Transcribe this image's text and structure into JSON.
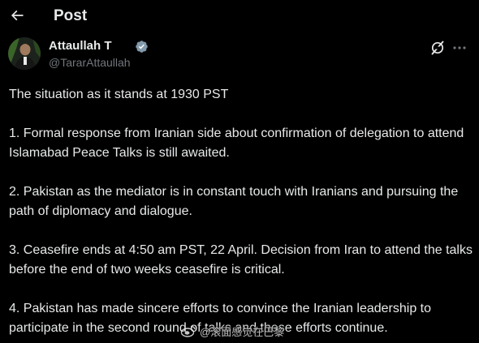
{
  "header": {
    "title": "Post"
  },
  "author": {
    "name": "Attaullah T",
    "handle": "@TararAttaullah",
    "verified": true,
    "verified_color": "#829aab"
  },
  "post": {
    "paragraphs": [
      "The situation as it stands at 1930 PST",
      "1. Formal response from Iranian side about confirmation of delegation to attend Islamabad Peace Talks is still awaited.",
      "2. Pakistan as the mediator is in constant touch with Iranians and pursuing the path of diplomacy and dialogue.",
      "3. Ceasefire ends at 4:50 am PST, 22 April. Decision from Iran to attend the talks before the end of two weeks ceasefire is critical.",
      "4. Pakistan has made sincere efforts to convince the Iranian leadership to participate in the second round of talks and these efforts continue."
    ]
  },
  "watermark": {
    "text": "@滚面感觉在巴黎"
  },
  "icons": {
    "back": "arrow-left-icon",
    "verified": "verified-badge-icon",
    "grok": "grok-icon",
    "more": "more-horizontal-icon",
    "weibo": "weibo-logo-icon"
  },
  "colors": {
    "background": "#000000",
    "text": "#e7e9ea",
    "secondary_text": "#71767b"
  }
}
